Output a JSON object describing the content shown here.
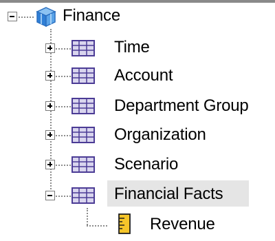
{
  "tree": {
    "root": {
      "label": "Finance",
      "icon": "cube-icon",
      "expanded": true
    },
    "dimensions": [
      {
        "label": "Time",
        "icon": "dimension-grid-icon",
        "expanded": false
      },
      {
        "label": "Account",
        "icon": "dimension-grid-icon",
        "expanded": false
      },
      {
        "label": "Department Group",
        "icon": "dimension-grid-icon",
        "expanded": false
      },
      {
        "label": "Organization",
        "icon": "dimension-grid-icon",
        "expanded": false
      },
      {
        "label": "Scenario",
        "icon": "dimension-grid-icon",
        "expanded": false
      },
      {
        "label": "Financial Facts",
        "icon": "measure-group-icon",
        "expanded": true,
        "selected": true
      }
    ],
    "measures": [
      {
        "label": "Revenue",
        "icon": "measure-ruler-icon"
      }
    ]
  },
  "colors": {
    "selection_bg": "#e5e5e5",
    "grid_fill": "#d9d5ee",
    "grid_border": "#4b3b95",
    "cube_blue": "#2f7fd6",
    "measure_yellow": "#f5c52a"
  }
}
